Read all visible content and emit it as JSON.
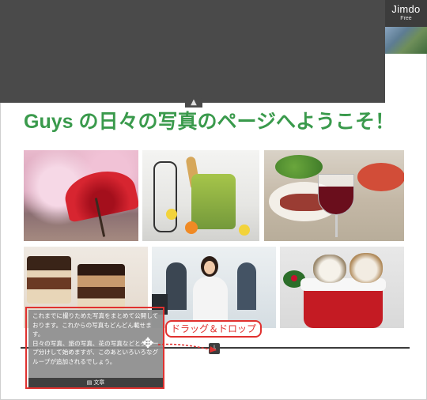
{
  "site": {
    "title": "Guys の日々の写真のページへようこそ！"
  },
  "badge": {
    "logo": "Jimdo",
    "plan": "Free"
  },
  "header": {
    "toggle_icon": "▲"
  },
  "gallery": {
    "photos": [
      {
        "name": "cherry-blossom-umbrella"
      },
      {
        "name": "kitchen-groceries"
      },
      {
        "name": "dinner-wine"
      },
      {
        "name": "cakes"
      },
      {
        "name": "office-call-center"
      },
      {
        "name": "kittens-stocking"
      }
    ]
  },
  "text_widget": {
    "paragraph1": "これまでに撮りためた写真をまとめて公開しております。これからの写真もどんどん載せます。",
    "paragraph2": "日々の写真、旅の写真、花の写真などとグループ分けして始めますが、このあといろいろなグループが追加されるでしょう。",
    "footer_label": "文章",
    "footer_icon": "document-icon"
  },
  "annotation": {
    "label": "ドラッグ＆ドロップ",
    "color": "#e0312f"
  },
  "colors": {
    "title_green": "#3a9a4c",
    "header_dark": "#4a4a4a",
    "highlight_red": "#e0312f"
  }
}
